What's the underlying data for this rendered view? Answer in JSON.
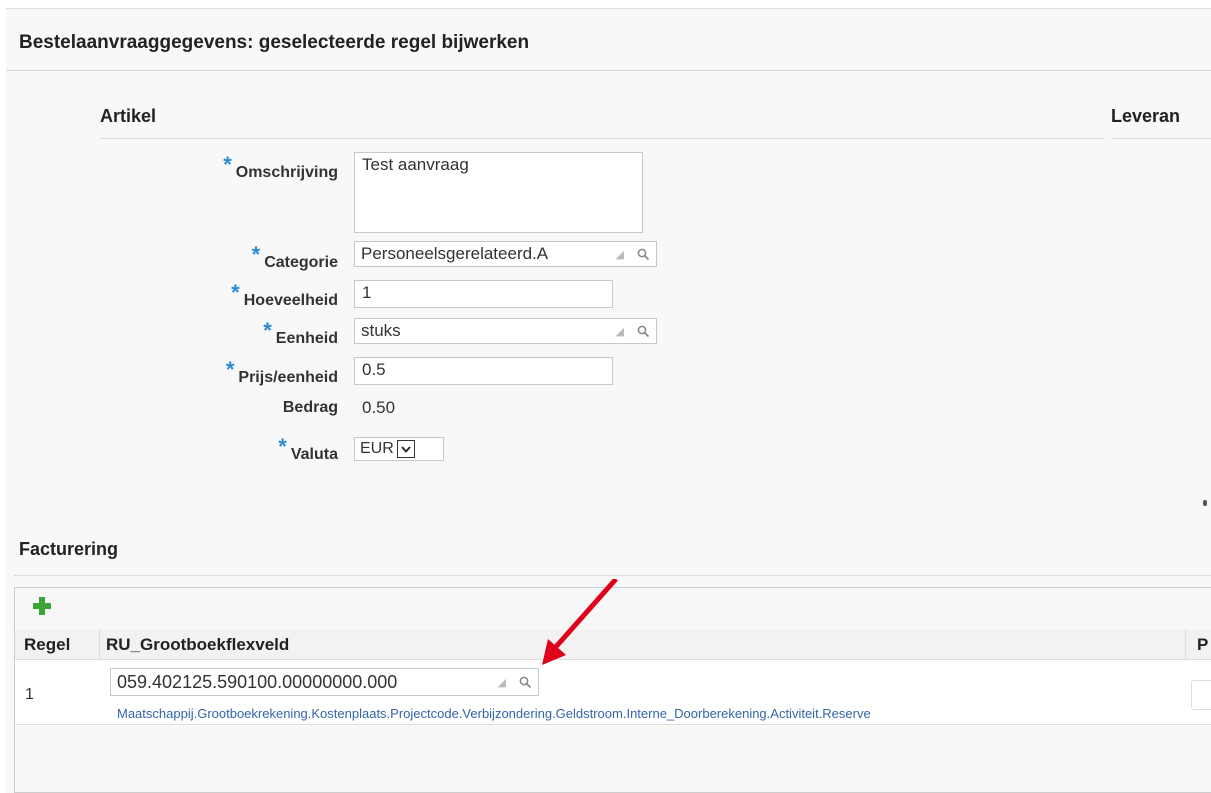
{
  "header": {
    "title": "Bestelaanvraaggegevens: geselecteerde regel bijwerken"
  },
  "artikel": {
    "heading": "Artikel",
    "fields": {
      "omschrijving": {
        "label": "Omschrijving",
        "value": "Test aanvraag",
        "required": true
      },
      "categorie": {
        "label": "Categorie",
        "value": "Personeelsgerelateerd.A",
        "required": true
      },
      "hoeveelheid": {
        "label": "Hoeveelheid",
        "value": "1",
        "required": true
      },
      "eenheid": {
        "label": "Eenheid",
        "value": "stuks",
        "required": true
      },
      "prijs": {
        "label": "Prijs/eenheid",
        "value": "0.5",
        "required": true
      },
      "bedrag": {
        "label": "Bedrag",
        "value": "0.50",
        "required": false
      },
      "valuta": {
        "label": "Valuta",
        "value": "EUR",
        "required": true
      }
    },
    "required_marker": "*"
  },
  "leverancier": {
    "heading": "Leveran"
  },
  "facturering": {
    "heading": "Facturering",
    "add_icon": "plus-icon",
    "columns": [
      "Regel",
      "RU_Grootboekflexveld",
      "P"
    ],
    "rows": [
      {
        "regel": "1",
        "grootboek": "059.402125.590100.00000000.000",
        "segments": "Maatschappij.Grootboekrekening.Kostenplaats.Projectcode.Verbijzondering.Geldstroom.Interne_Doorberekening.Activiteit.Reserve"
      }
    ]
  },
  "icons": {
    "search": "magnifier-icon",
    "annotation": "red-arrow-icon"
  },
  "colors": {
    "required": "#2a8ad6",
    "link": "#3366aa",
    "arrow": "#e0001a",
    "add": "#3aa536"
  }
}
